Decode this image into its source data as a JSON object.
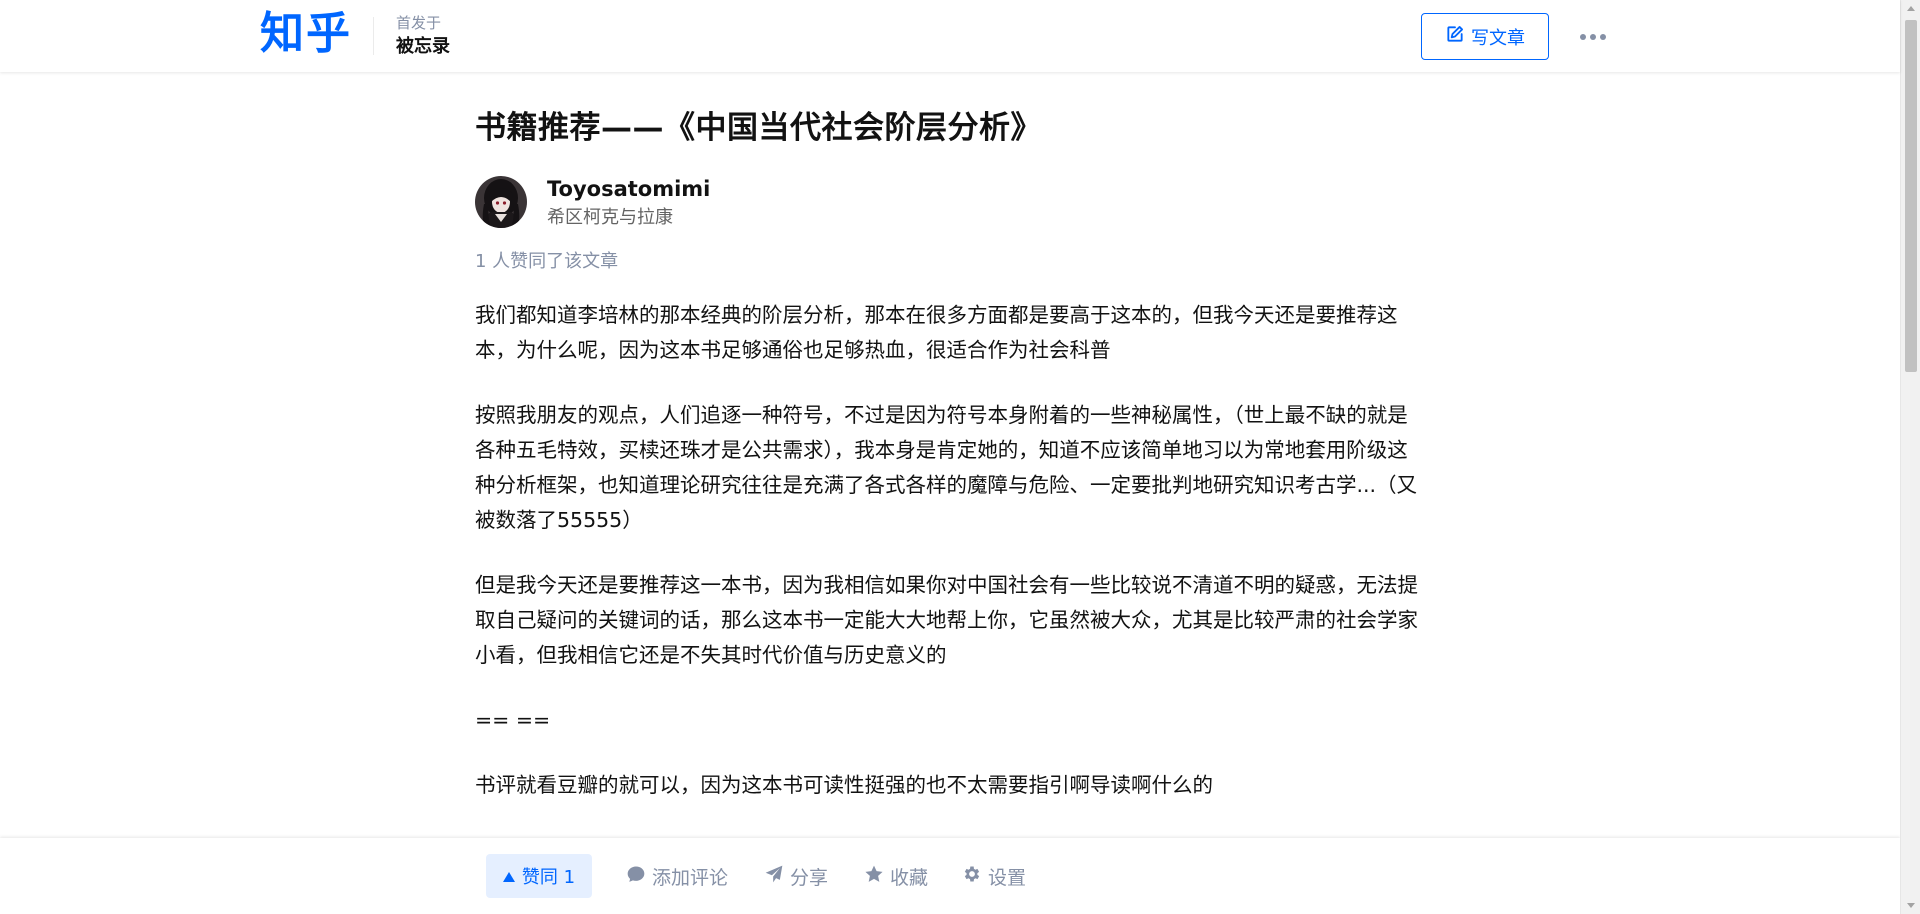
{
  "header": {
    "logo": "知乎",
    "published_label": "首发于",
    "column_name": "被忘录",
    "write_button": "写文章",
    "more_icon": "more-dots-icon"
  },
  "article": {
    "title": "书籍推荐——《中国当代社会阶层分析》",
    "author": {
      "name": "Toyosatomimi",
      "bio": "希区柯克与拉康"
    },
    "vote_summary": "1 人赞同了该文章",
    "paragraphs": [
      "我们都知道李培林的那本经典的阶层分析，那本在很多方面都是要高于这本的，但我今天还是要推荐这本，为什么呢，因为这本书足够通俗也足够热血，很适合作为社会科普",
      "按照我朋友的观点，人们追逐一种符号，不过是因为符号本身附着的一些神秘属性，（世上最不缺的就是各种五毛特效，买椟还珠才是公共需求），我本身是肯定她的，知道不应该简单地习以为常地套用阶级这种分析框架，也知道理论研究往往是充满了各式各样的魔障与危险、一定要批判地研究知识考古学...（又被数落了55555）",
      "但是我今天还是要推荐这一本书，因为我相信如果你对中国社会有一些比较说不清道不明的疑惑，无法提取自己疑问的关键词的话，那么这本书一定能大大地帮上你，它虽然被大众，尤其是比较严肃的社会学家小看，但我相信它还是不失其时代价值与历史意义的",
      "== ==",
      "书评就看豆瓣的就可以，因为这本书可读性挺强的也不太需要指引啊导读啊什么的"
    ]
  },
  "actions": {
    "vote": "赞同 1",
    "comment": "添加评论",
    "share": "分享",
    "favorite": "收藏",
    "settings": "设置"
  },
  "colors": {
    "brand": "#0066ff",
    "muted": "#8590a6",
    "text": "#121212"
  }
}
